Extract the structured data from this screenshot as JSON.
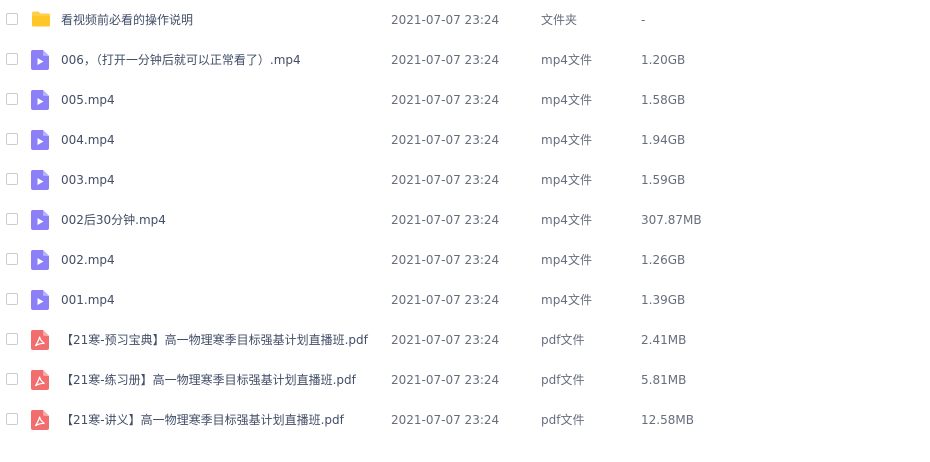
{
  "colors": {
    "folder": "#ffd14a",
    "video": "#8b80f7",
    "pdf": "#f26d6d"
  },
  "files": [
    {
      "icon": "folder-icon",
      "name": "看视频前必看的操作说明",
      "date": "2021-07-07 23:24",
      "type": "文件夹",
      "size": "-"
    },
    {
      "icon": "video-file-icon",
      "name": "006，（打开一分钟后就可以正常看了）.mp4",
      "date": "2021-07-07 23:24",
      "type": "mp4文件",
      "size": "1.20GB"
    },
    {
      "icon": "video-file-icon",
      "name": "005.mp4",
      "date": "2021-07-07 23:24",
      "type": "mp4文件",
      "size": "1.58GB"
    },
    {
      "icon": "video-file-icon",
      "name": "004.mp4",
      "date": "2021-07-07 23:24",
      "type": "mp4文件",
      "size": "1.94GB"
    },
    {
      "icon": "video-file-icon",
      "name": "003.mp4",
      "date": "2021-07-07 23:24",
      "type": "mp4文件",
      "size": "1.59GB"
    },
    {
      "icon": "video-file-icon",
      "name": "002后30分钟.mp4",
      "date": "2021-07-07 23:24",
      "type": "mp4文件",
      "size": "307.87MB"
    },
    {
      "icon": "video-file-icon",
      "name": "002.mp4",
      "date": "2021-07-07 23:24",
      "type": "mp4文件",
      "size": "1.26GB"
    },
    {
      "icon": "video-file-icon",
      "name": "001.mp4",
      "date": "2021-07-07 23:24",
      "type": "mp4文件",
      "size": "1.39GB"
    },
    {
      "icon": "pdf-file-icon",
      "name": "【21寒-预习宝典】高一物理寒季目标强基计划直播班.pdf",
      "date": "2021-07-07 23:24",
      "type": "pdf文件",
      "size": "2.41MB"
    },
    {
      "icon": "pdf-file-icon",
      "name": "【21寒-练习册】高一物理寒季目标强基计划直播班.pdf",
      "date": "2021-07-07 23:24",
      "type": "pdf文件",
      "size": "5.81MB"
    },
    {
      "icon": "pdf-file-icon",
      "name": "【21寒-讲义】高一物理寒季目标强基计划直播班.pdf",
      "date": "2021-07-07 23:24",
      "type": "pdf文件",
      "size": "12.58MB"
    }
  ]
}
